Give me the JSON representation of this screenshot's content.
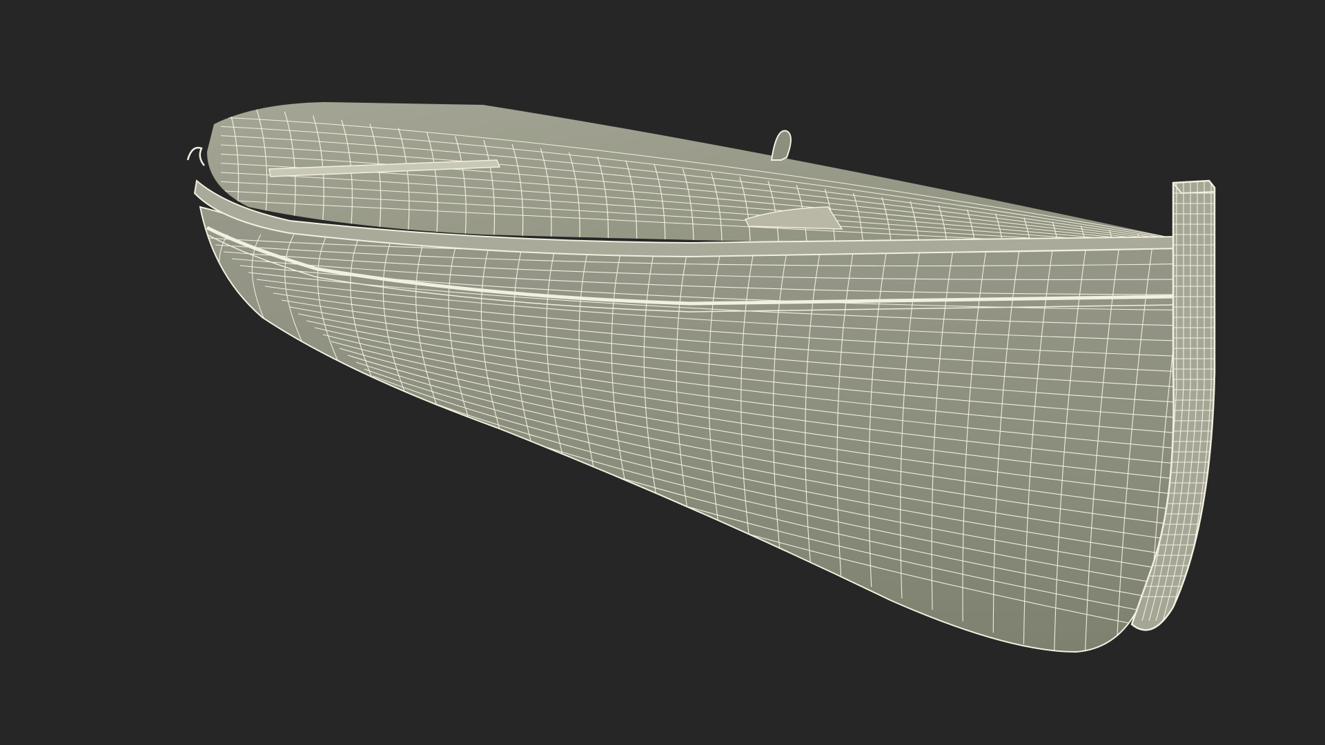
{
  "scene": {
    "background_color": "#262626",
    "model": "wooden-rowboat",
    "render_style": "wireframe-over-shaded",
    "surface_color": "#8e9080",
    "inner_surface_color": "#9fa08f",
    "wire_color": "#f2f0e0"
  }
}
